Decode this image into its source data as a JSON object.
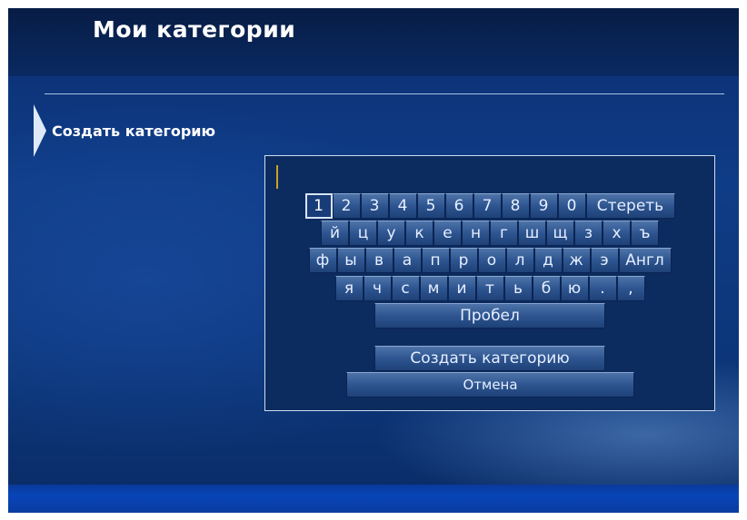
{
  "header": {
    "title": "Мои категории"
  },
  "section": {
    "title": "Создать категорию"
  },
  "keyboard": {
    "rows": [
      [
        "1",
        "2",
        "3",
        "4",
        "5",
        "6",
        "7",
        "8",
        "9",
        "0",
        "Стереть"
      ],
      [
        "й",
        "ц",
        "у",
        "к",
        "е",
        "н",
        "г",
        "ш",
        "щ",
        "з",
        "х",
        "ъ"
      ],
      [
        "ф",
        "ы",
        "в",
        "а",
        "п",
        "р",
        "о",
        "л",
        "д",
        "ж",
        "э",
        "Англ"
      ],
      [
        "я",
        "ч",
        "с",
        "м",
        "и",
        "т",
        "ь",
        "б",
        "ю",
        ".",
        ","
      ]
    ],
    "space_label": "Пробел",
    "selected_key": "1"
  },
  "actions": {
    "create_label": "Создать категорию",
    "cancel_label": "Отмена"
  }
}
